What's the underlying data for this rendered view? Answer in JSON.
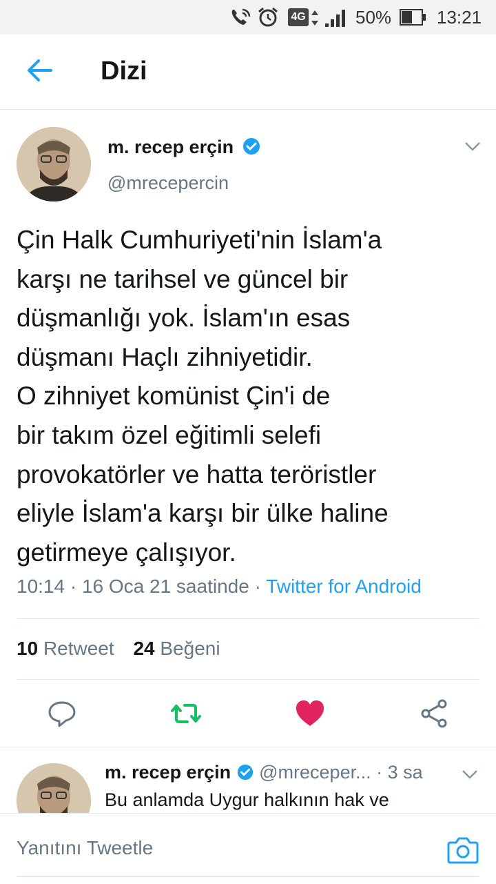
{
  "status_bar": {
    "network": "4G",
    "battery": "50%",
    "time": "13:21"
  },
  "header": {
    "title": "Dizi"
  },
  "tweet": {
    "author_name": "m. recep erçin",
    "handle": "@mrecepercin",
    "verified": true,
    "text": "Çin Halk Cumhuriyeti'nin İslam'a\nkarşı ne tarihsel ve güncel bir\ndüşmanlığı yok. İslam'ın esas\ndüşmanı Haçlı zihniyetidir.\nO zihniyet komünist Çin'i de\nbir takım özel eğitimli selefi\nprovokatörler ve hatta teröristler\neliyle İslam'a karşı bir ülke haline\ngetirmeye çalışıyor.",
    "time_text": "10:14 · 16 Oca 21 saatinde · ",
    "source": "Twitter for Android",
    "retweet_count": "10",
    "retweet_label": "Retweet",
    "like_count": "24",
    "like_label": "Beğeni"
  },
  "reply": {
    "author_name": "m. recep erçin",
    "handle": "@mreceper...",
    "age": "· 3 sa",
    "text": "Bu anlamda Uygur halkının hak ve"
  },
  "compose": {
    "placeholder": "Yanıtını Tweetle"
  },
  "colors": {
    "accent": "#1da1f2",
    "retweet": "#17bf63",
    "like": "#e0245e",
    "secondary": "#657786"
  }
}
